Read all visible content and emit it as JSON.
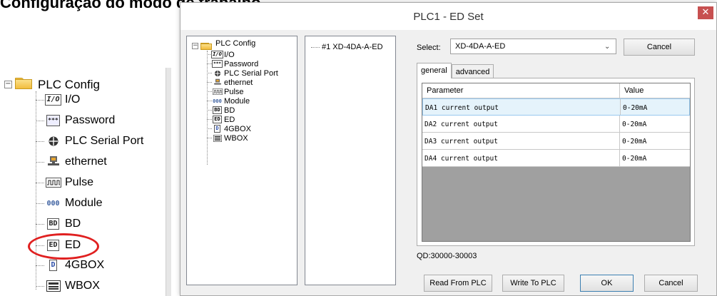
{
  "page": {
    "heading": "Configuração do modo de trabalho"
  },
  "page_tree": {
    "root_label": "PLC Config",
    "items": [
      {
        "label": "I/O",
        "icon": "io-icon",
        "icon_text": "I/O"
      },
      {
        "label": "Password",
        "icon": "password-icon",
        "icon_text": "***"
      },
      {
        "label": "PLC Serial Port",
        "icon": "serial-port-icon",
        "icon_text": ""
      },
      {
        "label": "ethernet",
        "icon": "ethernet-icon",
        "icon_text": ""
      },
      {
        "label": "Pulse",
        "icon": "pulse-icon",
        "icon_text": ""
      },
      {
        "label": "Module",
        "icon": "module-icon",
        "icon_text": "000"
      },
      {
        "label": "BD",
        "icon": "bd-icon",
        "icon_text": "BD"
      },
      {
        "label": "ED",
        "icon": "ed-icon",
        "icon_text": "ED"
      },
      {
        "label": "4GBOX",
        "icon": "4gbox-icon",
        "icon_text": "D"
      },
      {
        "label": "WBOX",
        "icon": "wbox-icon",
        "icon_text": ""
      }
    ],
    "highlight_color": "#e02020"
  },
  "dialog": {
    "title": "PLC1 - ED Set",
    "close_label": "✕",
    "tree": {
      "root_label": "PLC Config",
      "items": [
        "I/O",
        "Password",
        "PLC Serial Port",
        "ethernet",
        "Pulse",
        "Module",
        "BD",
        "ED",
        "4GBOX",
        "WBOX"
      ]
    },
    "module_list": {
      "items": [
        "#1 XD-4DA-A-ED"
      ]
    },
    "select_label": "Select:",
    "select_value": "XD-4DA-A-ED",
    "cancel_top_label": "Cancel",
    "tabs": [
      "general",
      "advanced"
    ],
    "active_tab": "general",
    "table": {
      "headers": [
        "Parameter",
        "Value"
      ],
      "rows": [
        {
          "parameter": "DA1 current output",
          "value": "0-20mA",
          "selected": true
        },
        {
          "parameter": "DA2 current output",
          "value": "0-20mA",
          "selected": false
        },
        {
          "parameter": "DA3 current output",
          "value": "0-20mA",
          "selected": false
        },
        {
          "parameter": "DA4 current output",
          "value": "0-20mA",
          "selected": false
        }
      ]
    },
    "qd_range": "QD:30000-30003",
    "buttons": {
      "read": "Read From PLC",
      "write": "Write To PLC",
      "ok": "OK",
      "cancel": "Cancel"
    },
    "colors": {
      "close_button": "#c75050",
      "selected_row": "#e5f3fb"
    }
  }
}
